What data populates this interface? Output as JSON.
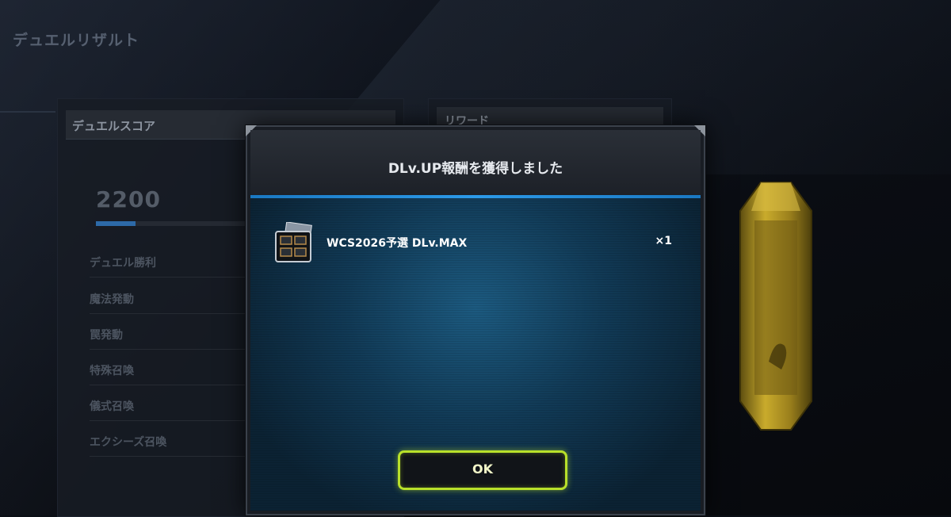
{
  "screen": {
    "title": "デュエルリザルト"
  },
  "score_panel": {
    "header": "デュエルスコア",
    "score": "2200",
    "score_progress": 0.25,
    "rows": [
      "デュエル勝利",
      "魔法発動",
      "罠発動",
      "特殊召喚",
      "儀式召喚",
      "エクシーズ召喚"
    ]
  },
  "reward_panel": {
    "header": "リワード"
  },
  "dialog": {
    "title": "DLv.UP報酬を獲得しました",
    "reward": {
      "icon": "deck-case-icon",
      "name": "WCS2026予選 DLv.MAX",
      "quantity": "×1"
    },
    "ok_label": "OK"
  },
  "colors": {
    "accent_blue": "#2c9ae8",
    "ok_border": "#b8e02a",
    "crystal": "#b59a22"
  }
}
